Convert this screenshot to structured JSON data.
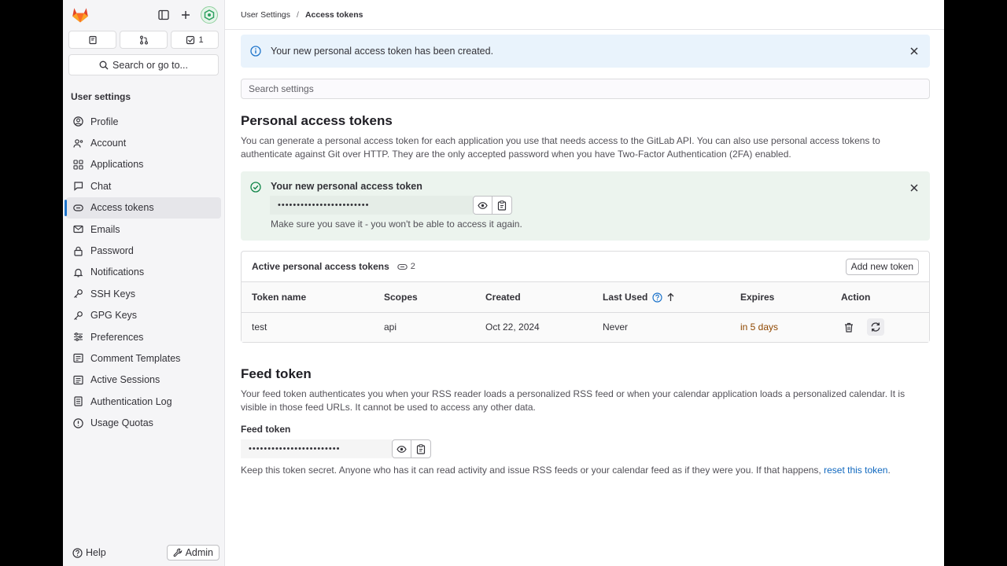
{
  "breadcrumb": {
    "parent": "User Settings",
    "separator": "/",
    "current": "Access tokens"
  },
  "sidebar": {
    "search_label": "Search or go to...",
    "todo_count": "1",
    "heading": "User settings",
    "items": [
      {
        "label": "Profile",
        "icon": "profile-icon"
      },
      {
        "label": "Account",
        "icon": "account-icon"
      },
      {
        "label": "Applications",
        "icon": "applications-icon"
      },
      {
        "label": "Chat",
        "icon": "chat-icon"
      },
      {
        "label": "Access tokens",
        "icon": "token-icon"
      },
      {
        "label": "Emails",
        "icon": "mail-icon"
      },
      {
        "label": "Password",
        "icon": "lock-icon"
      },
      {
        "label": "Notifications",
        "icon": "bell-icon"
      },
      {
        "label": "SSH Keys",
        "icon": "key-icon"
      },
      {
        "label": "GPG Keys",
        "icon": "key-icon"
      },
      {
        "label": "Preferences",
        "icon": "preferences-icon"
      },
      {
        "label": "Comment Templates",
        "icon": "comment-icon"
      },
      {
        "label": "Active Sessions",
        "icon": "monitor-icon"
      },
      {
        "label": "Authentication Log",
        "icon": "log-icon"
      },
      {
        "label": "Usage Quotas",
        "icon": "quota-icon"
      }
    ],
    "active_item": "Access tokens",
    "help_label": "Help",
    "admin_label": "Admin"
  },
  "info_alert": {
    "text": "Your new personal access token has been created."
  },
  "search_settings": {
    "placeholder": "Search settings"
  },
  "pat": {
    "title": "Personal access tokens",
    "description": "You can generate a personal access token for each application you use that needs access to the GitLab API. You can also use personal access tokens to authenticate against Git over HTTP. They are the only accepted password when you have Two-Factor Authentication (2FA) enabled.",
    "new_token_title": "Your new personal access token",
    "new_token_masked": "••••••••••••••••••••••••",
    "new_token_help": "Make sure you save it - you won't be able to access it again."
  },
  "active_tokens": {
    "title": "Active personal access tokens",
    "count": "2",
    "add_button": "Add new token",
    "columns": [
      "Token name",
      "Scopes",
      "Created",
      "Last Used",
      "Expires",
      "Action"
    ],
    "rows": [
      {
        "name": "test",
        "scopes": "api",
        "created": "Oct 22, 2024",
        "last_used": "Never",
        "expires": "in 5 days"
      }
    ]
  },
  "feed": {
    "title": "Feed token",
    "description": "Your feed token authenticates you when your RSS reader loads a personalized RSS feed or when your calendar application loads a personalized calendar. It is visible in those feed URLs. It cannot be used to access any other data.",
    "label": "Feed token",
    "masked": "••••••••••••••••••••••••",
    "help_prefix": "Keep this token secret. Anyone who has it can read activity and issue RSS feeds or your calendar feed as if they were you. If that happens,",
    "help_link": "reset this token",
    "help_suffix": "."
  },
  "colors": {
    "accent_blue": "#1f75cb",
    "link": "#1068bf",
    "success_bg": "#ecf4ee",
    "info_bg": "#e9f3fc",
    "warning_text": "#8f4700"
  }
}
